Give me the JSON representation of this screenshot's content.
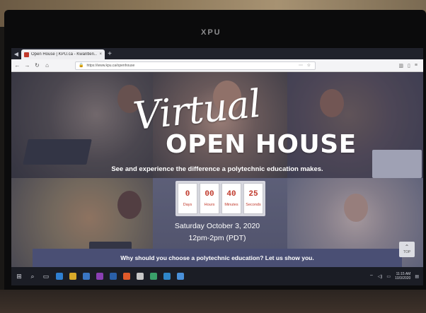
{
  "device": {
    "brand": "XPU"
  },
  "browser": {
    "tab_title": "Open House | KPU.ca - Kwantlen...",
    "url": "https://www.kpu.ca/openhouse",
    "nav": {
      "back": "←",
      "forward": "→",
      "reload": "↻",
      "home": "⌂"
    },
    "new_tab": "+",
    "tab_close": "×"
  },
  "page": {
    "title_script": "Virtual",
    "title_main": "OPEN HOUSE",
    "tagline": "See and experience the difference a polytechnic education makes.",
    "countdown": [
      {
        "value": "0",
        "label": "Days"
      },
      {
        "value": "00",
        "label": "Hours"
      },
      {
        "value": "40",
        "label": "Minutes"
      },
      {
        "value": "25",
        "label": "Seconds"
      }
    ],
    "event_date": "Saturday October 3, 2020",
    "event_time": "12pm-2pm (PDT)",
    "banner_text": "Why should you choose a polytechnic education? Let us show you.",
    "top_button": {
      "arrow": "⌃",
      "label": "TOP"
    }
  },
  "taskbar": {
    "clock_time": "11:15 AM",
    "clock_date": "10/3/2020"
  },
  "colors": {
    "countdown_red": "#c0392b",
    "banner": "#4a4f74",
    "taskbar": "#1b1d25"
  }
}
